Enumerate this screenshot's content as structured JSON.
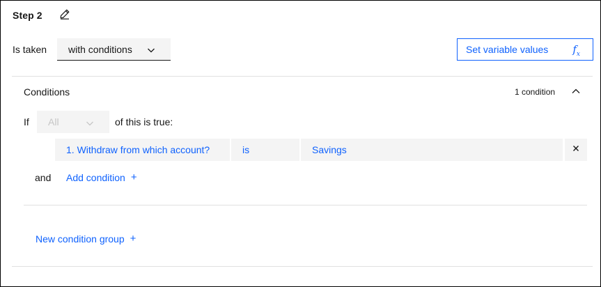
{
  "step": {
    "title": "Step 2"
  },
  "taken": {
    "label": "Is taken",
    "selected": "with conditions"
  },
  "set_variable": {
    "label": "Set variable values",
    "fx": "f",
    "fx_sub": "x"
  },
  "conditions": {
    "title": "Conditions",
    "count": "1 condition",
    "if_label": "If",
    "quantifier": "All",
    "of_label": "of this is true:",
    "rows": [
      {
        "question": "1. Withdraw from which account?",
        "operator": "is",
        "value": "Savings",
        "remove": "×"
      }
    ],
    "and_label": "and",
    "add_condition": "Add condition",
    "add_plus": "+"
  },
  "new_group": {
    "label": "New condition group",
    "plus": "+"
  },
  "colors": {
    "accent": "#0f62fe",
    "field_bg": "#f4f4f4",
    "divider": "#e0e0e0",
    "text": "#161616"
  }
}
